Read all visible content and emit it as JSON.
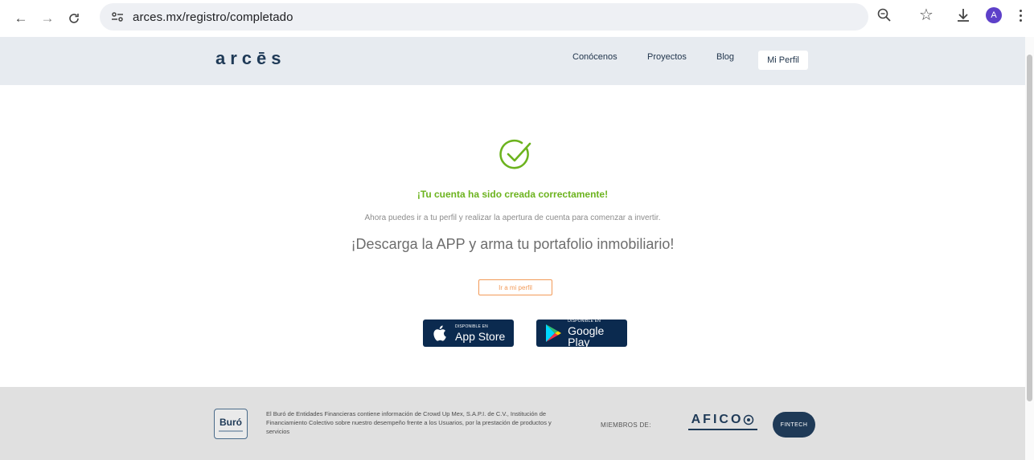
{
  "browser": {
    "url": "arces.mx/registro/completado",
    "avatar_letter": "A"
  },
  "header": {
    "logo": "arcēs",
    "nav": [
      {
        "label": "Conócenos"
      },
      {
        "label": "Proyectos"
      },
      {
        "label": "Blog"
      },
      {
        "label": "Mi Perfil"
      }
    ]
  },
  "main": {
    "success_title": "¡Tu cuenta ha sido creada correctamente!",
    "success_subtitle": "Ahora puedes ir a tu perfil y realizar la apertura de cuenta para comenzar a invertir.",
    "download_title": "¡Descarga la APP y arma tu portafolio inmobiliario!",
    "profile_button": "Ir a mi perfil",
    "app_store": {
      "small": "DISPONIBLE EN",
      "big": "App Store"
    },
    "google_play": {
      "small": "DISPONIBLE EN",
      "big": "Google Play"
    }
  },
  "footer": {
    "buro_label": "Buró",
    "disclaimer": "El Buró de Entidades Financieras contiene información de Crowd Up Mex, S.A.P.I. de C.V., Institución de Financiamiento Colectivo sobre nuestro desempeño frente a los Usuarios, por la prestación de productos y servicios",
    "miembros_label": "MIEMBROS DE:",
    "afico_label": "AFICO",
    "fintech_label": "FINTECH"
  },
  "colors": {
    "accent_green": "#6cb31e",
    "accent_orange": "#f29a58",
    "brand_navy": "#1f3a57"
  }
}
